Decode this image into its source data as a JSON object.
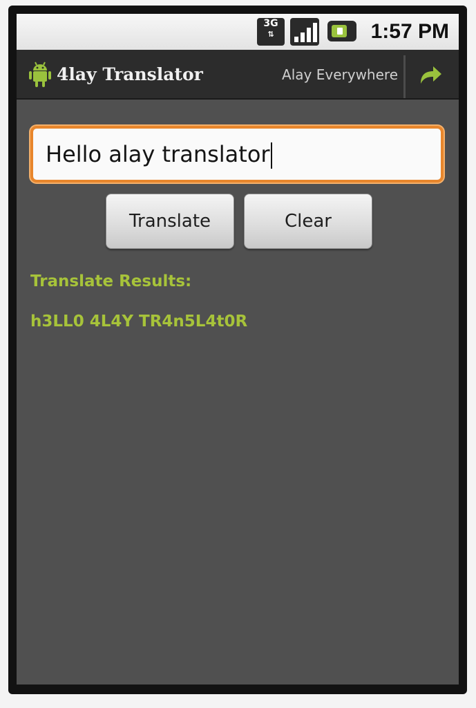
{
  "status_bar": {
    "network_type": "3G",
    "network_arrows": "⇅",
    "time": "1:57 PM",
    "icons": [
      "3g-icon",
      "signal-icon",
      "battery-icon"
    ]
  },
  "action_bar": {
    "app_title": "4lay Translator",
    "subtitle": "Alay Everywhere",
    "logo_icon": "android-logo-icon",
    "share_icon": "share-arrow-icon"
  },
  "input": {
    "value": "Hello alay translator"
  },
  "buttons": {
    "translate_label": "Translate",
    "clear_label": "Clear"
  },
  "results": {
    "heading": "Translate Results:",
    "output": "h3LL0 4L4Y TR4n5L4t0R"
  },
  "colors": {
    "background": "#505050",
    "action_bar": "#2c2c2c",
    "accent_green": "#a7c33a",
    "focus_orange": "#e8862c"
  }
}
